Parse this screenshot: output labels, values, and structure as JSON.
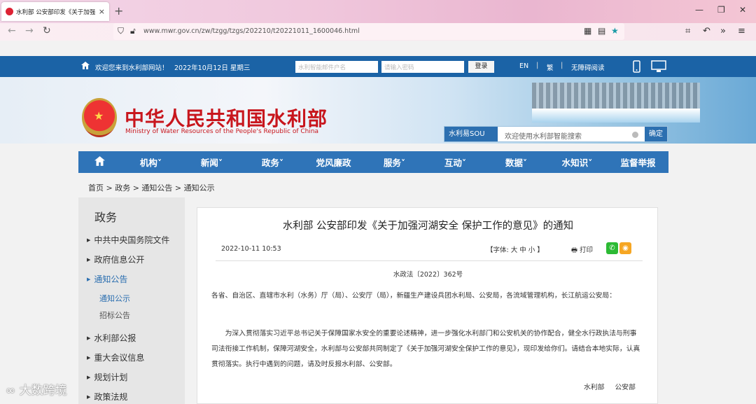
{
  "browser": {
    "tab_title": "水利部 公安部印发《关于加强...",
    "tab_close": "×",
    "new_tab": "+",
    "url": "www.mwr.gov.cn/zw/tzgg/tzgs/202210/t20221011_1600046.html",
    "nav_back": "←",
    "nav_forward": "→",
    "nav_reload": "↻",
    "win_min": "—",
    "win_max": "❐",
    "win_close": "✕"
  },
  "topbar": {
    "welcome": "欢迎您来到水利部网站！",
    "date": "2022年10月12日 星期三",
    "username_placeholder": "水利智能邮件户名",
    "password_placeholder": "请输入密码",
    "login": "登录",
    "lang_en": "EN",
    "lang_trad": "繁",
    "accessible": "无障碍阅读",
    "sep": "|"
  },
  "banner": {
    "title_cn": "中华人民共和国水利部",
    "title_en": "Ministry of Water Resources of the People's Republic of China",
    "search_brand": "水利易SOU",
    "search_placeholder": "欢迎使用水利部智能搜索",
    "search_button": "确定"
  },
  "mainnav": {
    "home_icon": "home-icon",
    "items": [
      "机构˅",
      "新闻˅",
      "政务˅",
      "党风廉政",
      "服务˅",
      "互动˅",
      "数据˅",
      "水知识˅",
      "监督举报"
    ]
  },
  "breadcrumb": "首页 > 政务 > 通知公告 > 通知公示",
  "sidebar": {
    "title": "政务",
    "items": [
      "中共中央国务院文件",
      "政府信息公开",
      "通知公告",
      "水利部公报",
      "重大会议信息",
      "规划计划",
      "政策法规"
    ],
    "subitems": [
      "通知公示",
      "招标公告"
    ],
    "arrow": "▶"
  },
  "article": {
    "title": "水利部 公安部印发《关于加强河湖安全 保护工作的意见》的通知",
    "date": "2022-10-11 10:53",
    "font_size": "【字体:  大  中  小 】",
    "print": "打印",
    "doc_no": "水政法〔2022〕362号",
    "salutation": "各省、自治区、直辖市水利（水务）厅（局）、公安厅（局），新疆生产建设兵团水利局、公安局，各流域管理机构，长江航运公安局：",
    "body": "为深入贯彻落实习近平总书记关于保障国家水安全的重要论述精神，进一步强化水利部门和公安机关的协作配合，健全水行政执法与刑事司法衔接工作机制，保障河湖安全，水利部与公安部共同制定了《关于加强河湖安全保护工作的意见》，现印发给你们。请结合本地实际，认真贯彻落实。执行中遇到的问题，请及时反报水利部、公安部。",
    "signature": "水利部 公安部"
  },
  "watermark": "大数跨境"
}
